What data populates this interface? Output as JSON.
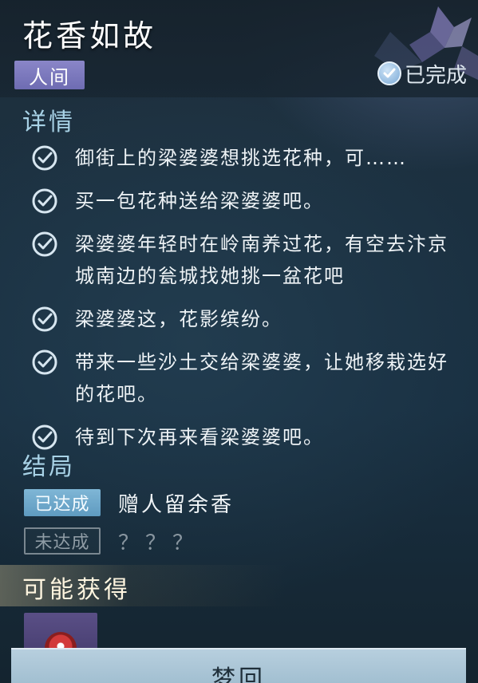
{
  "quest": {
    "title": "花香如故",
    "realm_tag": "人间",
    "status_label": "已完成"
  },
  "details": {
    "heading": "详情",
    "items": [
      {
        "text": "御街上的梁婆婆想挑选花种，可……"
      },
      {
        "text": "买一包花种送给梁婆婆吧。"
      },
      {
        "text": "梁婆婆年轻时在岭南养过花，有空去汴京城南边的瓮城找她挑一盆花吧"
      },
      {
        "text": "梁婆婆这，花影缤纷。"
      },
      {
        "text": "带来一些沙土交给梁婆婆，让她移栽选好的花吧。"
      },
      {
        "text": "待到下次再来看梁婆婆吧。"
      }
    ]
  },
  "ending": {
    "heading": "结局",
    "rows": [
      {
        "badge": "已达成",
        "text": "赠人留余香"
      },
      {
        "badge": "未达成",
        "text": "？？？"
      }
    ]
  },
  "rewards": {
    "heading": "可能获得"
  },
  "footer": {
    "button_label": "梦回"
  },
  "colors": {
    "accent": "#a8d2e6",
    "badge_done": "#6fa8ca",
    "tag_purple": "#7a78bd",
    "button": "#a9c5d6"
  }
}
